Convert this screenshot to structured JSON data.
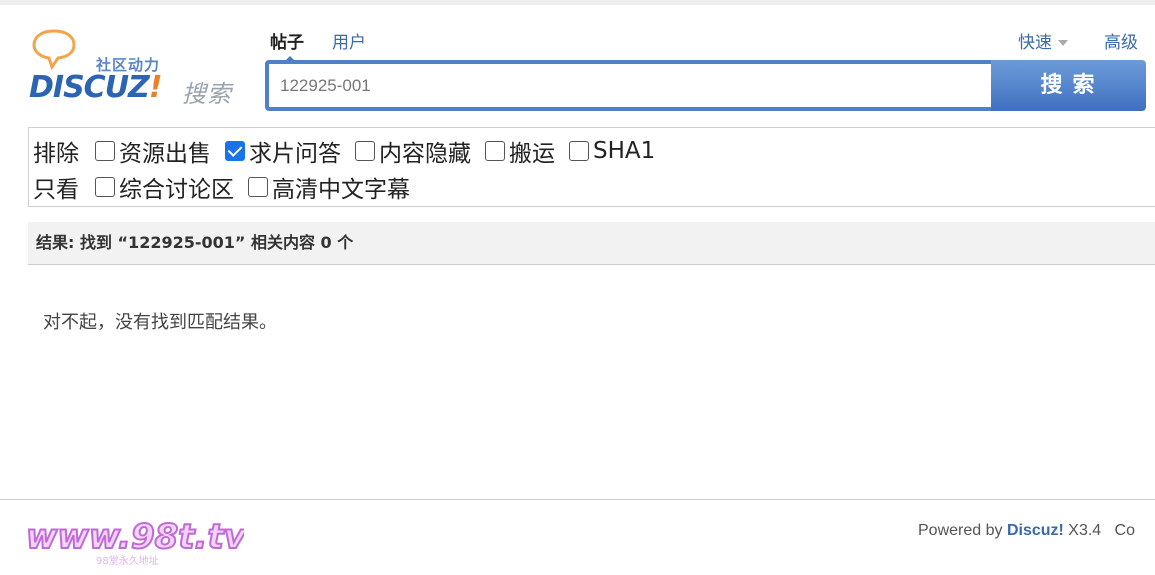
{
  "logo": {
    "slogan": "社区动力",
    "brand": "DISCUZ",
    "brand_mark": "!",
    "search_word": "搜索"
  },
  "tabs": [
    {
      "label": "帖子",
      "active": true
    },
    {
      "label": "用户",
      "active": false
    }
  ],
  "toplinks": {
    "quick": "快速",
    "advanced": "高级"
  },
  "search": {
    "value": "122925-001",
    "button": "搜索"
  },
  "filters": {
    "exclude_label": "排除",
    "exclude_options": [
      {
        "label": "资源出售",
        "checked": false
      },
      {
        "label": "求片问答",
        "checked": true
      },
      {
        "label": "内容隐藏",
        "checked": false
      },
      {
        "label": "搬运",
        "checked": false
      },
      {
        "label": "SHA1",
        "checked": false
      }
    ],
    "only_label": "只看",
    "only_options": [
      {
        "label": "综合讨论区",
        "checked": false
      },
      {
        "label": "高清中文字幕",
        "checked": false
      }
    ]
  },
  "result": {
    "summary": "结果: 找到 “122925-001” 相关内容 0 个",
    "empty_message": "对不起，没有找到匹配结果。"
  },
  "footer": {
    "watermark": "www.98t.tv",
    "watermark_sub": "98堂永久地址",
    "powered_prefix": "Powered by ",
    "powered_brand": "Discuz!",
    "powered_version": " X3.4",
    "powered_tail": "Co"
  },
  "colors": {
    "accent": "#4f80c9",
    "link": "#3a6aa8",
    "checkbox_checked": "#1a73e8"
  }
}
